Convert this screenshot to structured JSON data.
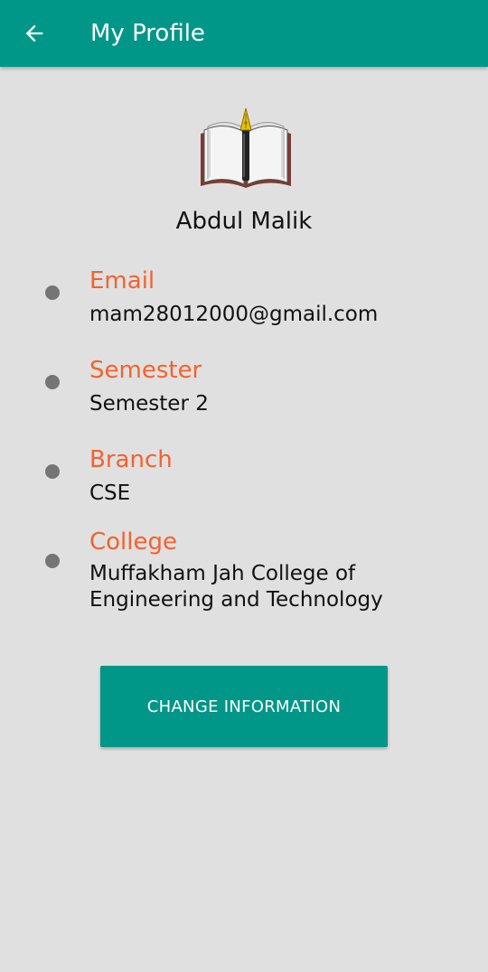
{
  "app_bar": {
    "title": "My Profile",
    "back_icon": "arrow-left-icon"
  },
  "profile": {
    "logo_icon": "open-book-with-pen-icon",
    "name": "Abdul Malik"
  },
  "info": [
    {
      "label": "Email",
      "value": "mam28012000@gmail.com"
    },
    {
      "label": "Semester",
      "value": "Semester 2"
    },
    {
      "label": "Branch",
      "value": "CSE"
    },
    {
      "label": "College",
      "value": "Muffakham Jah College of Engineering and Technology"
    }
  ],
  "actions": {
    "change_label": "CHANGE INFORMATION"
  },
  "colors": {
    "primary": "#009688",
    "accent_label": "#f4622d",
    "background": "#e0e0e0",
    "bullet": "#757575"
  }
}
